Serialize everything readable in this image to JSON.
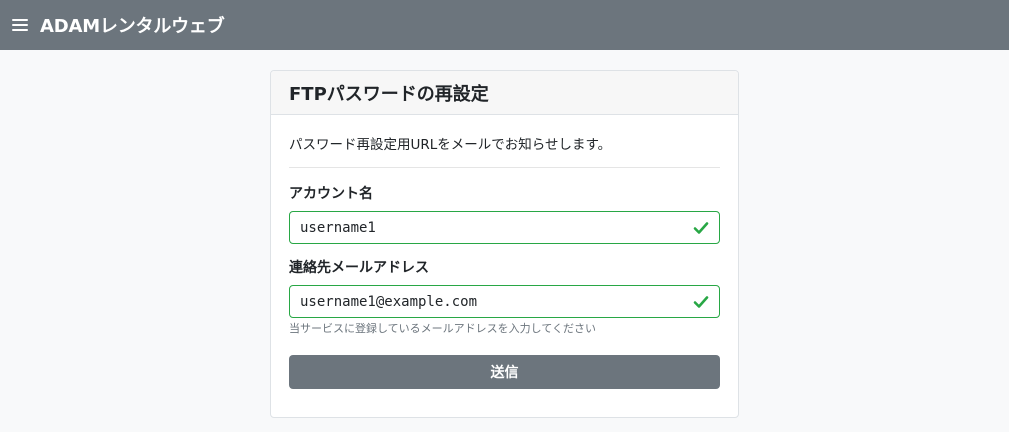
{
  "header": {
    "menu_icon": "hamburger-menu-icon",
    "brand": "ADAMレンタルウェブ"
  },
  "card": {
    "title": "FTPパスワードの再設定",
    "description": "パスワード再設定用URLをメールでお知らせします。",
    "account": {
      "label": "アカウント名",
      "value": "username1",
      "status_icon": "check-icon"
    },
    "email": {
      "label": "連絡先メールアドレス",
      "value": "username1@example.com",
      "status_icon": "check-icon",
      "help": "当サービスに登録しているメールアドレスを入力してください"
    },
    "submit_label": "送信"
  },
  "colors": {
    "header_bg": "#6c757d",
    "valid_green": "#28a745",
    "button_bg": "#6c757d",
    "page_bg": "#f8f9fa"
  }
}
